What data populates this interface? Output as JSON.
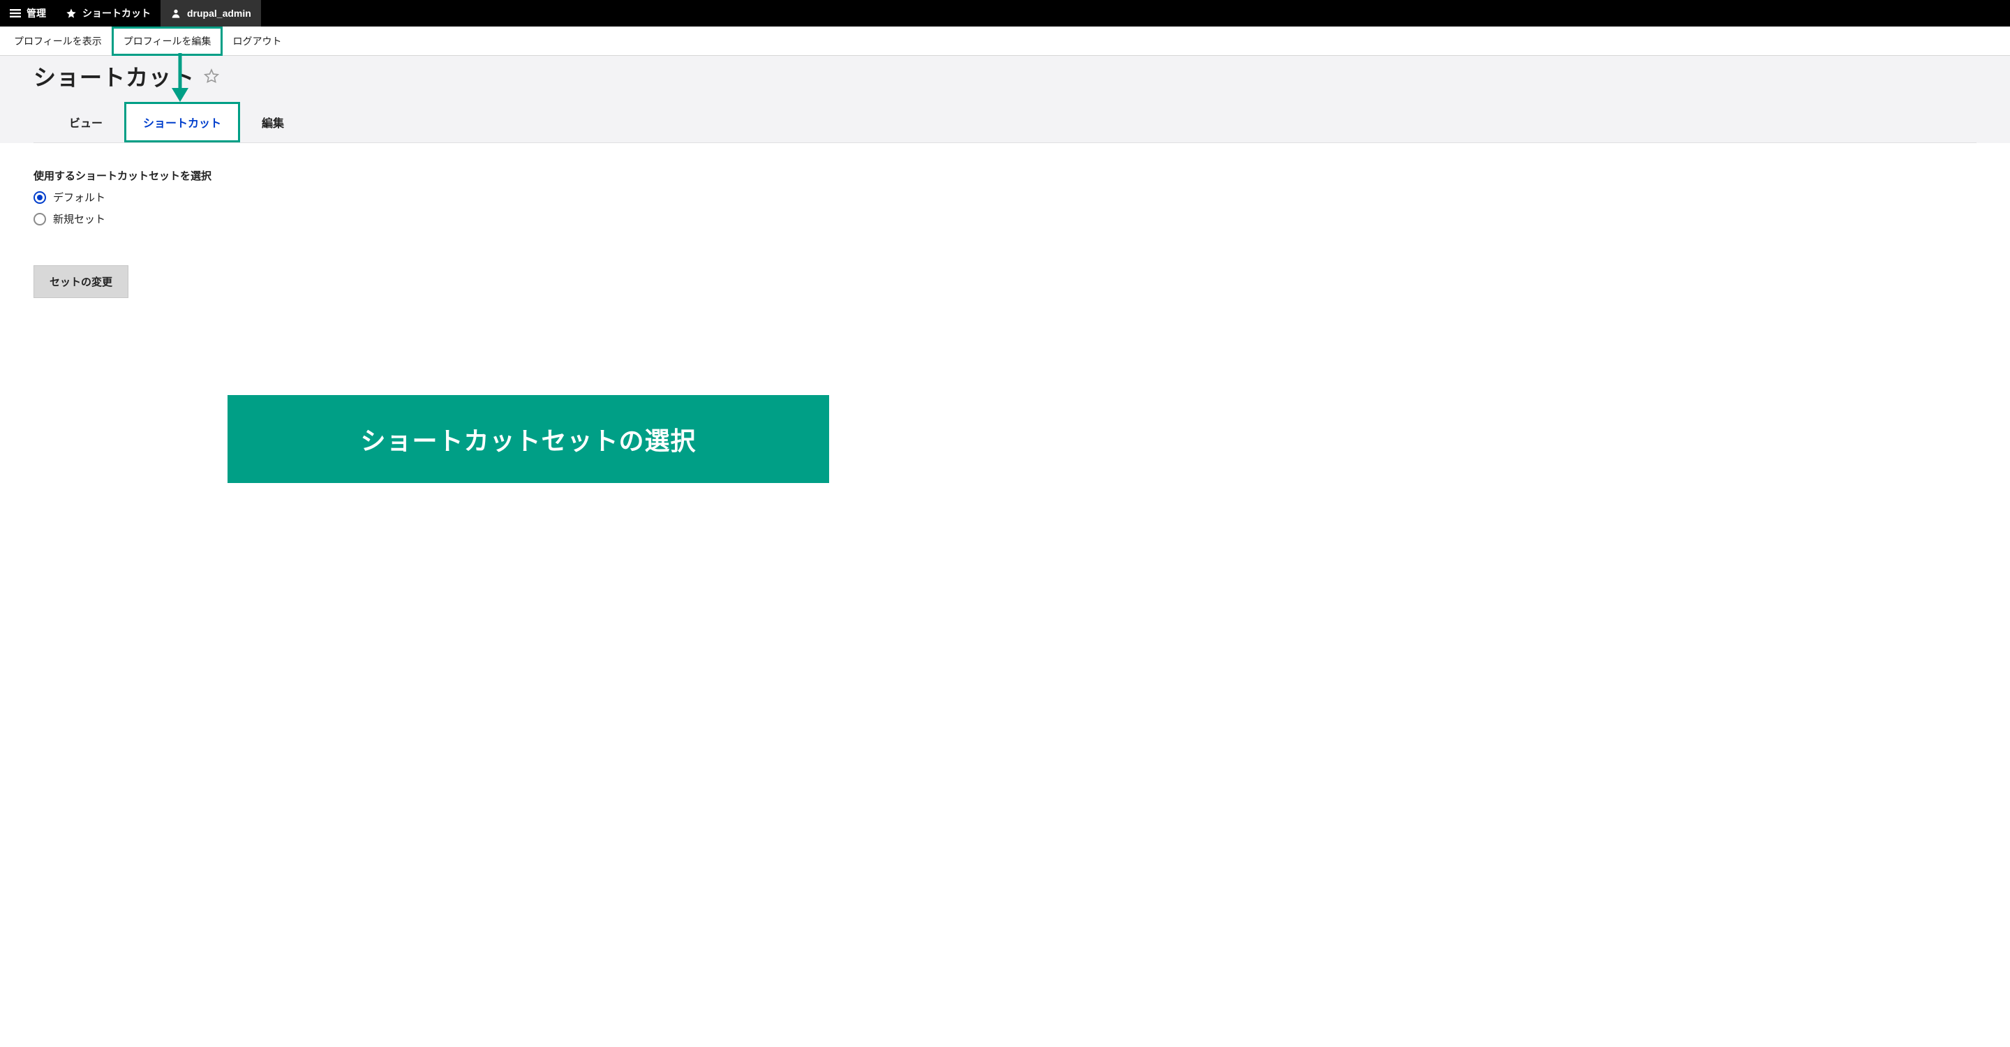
{
  "toolbar": {
    "manage_label": "管理",
    "shortcuts_label": "ショートカット",
    "user_label": "drupal_admin",
    "icons": {
      "hamburger": "hamburger-icon",
      "star": "star-icon",
      "user": "user-icon"
    }
  },
  "subnav": {
    "view_profile_label": "プロフィールを表示",
    "edit_profile_label": "プロフィールを編集",
    "logout_label": "ログアウト"
  },
  "page": {
    "crumb_fragment": "",
    "title": "ショートカット",
    "star_icon": "star-outline-icon"
  },
  "tabs": [
    {
      "label": "ビュー",
      "active": false
    },
    {
      "label": "ショートカット",
      "active": true
    },
    {
      "label": "編集",
      "active": false
    }
  ],
  "form": {
    "field_label": "使用するショートカットセットを選択",
    "options": [
      {
        "label": "デフォルト",
        "checked": true
      },
      {
        "label": "新規セット",
        "checked": false
      }
    ],
    "submit_label": "セットの変更"
  },
  "annotation": {
    "callout_text": "ショートカットセットの選択",
    "accent_color": "#009f86"
  }
}
